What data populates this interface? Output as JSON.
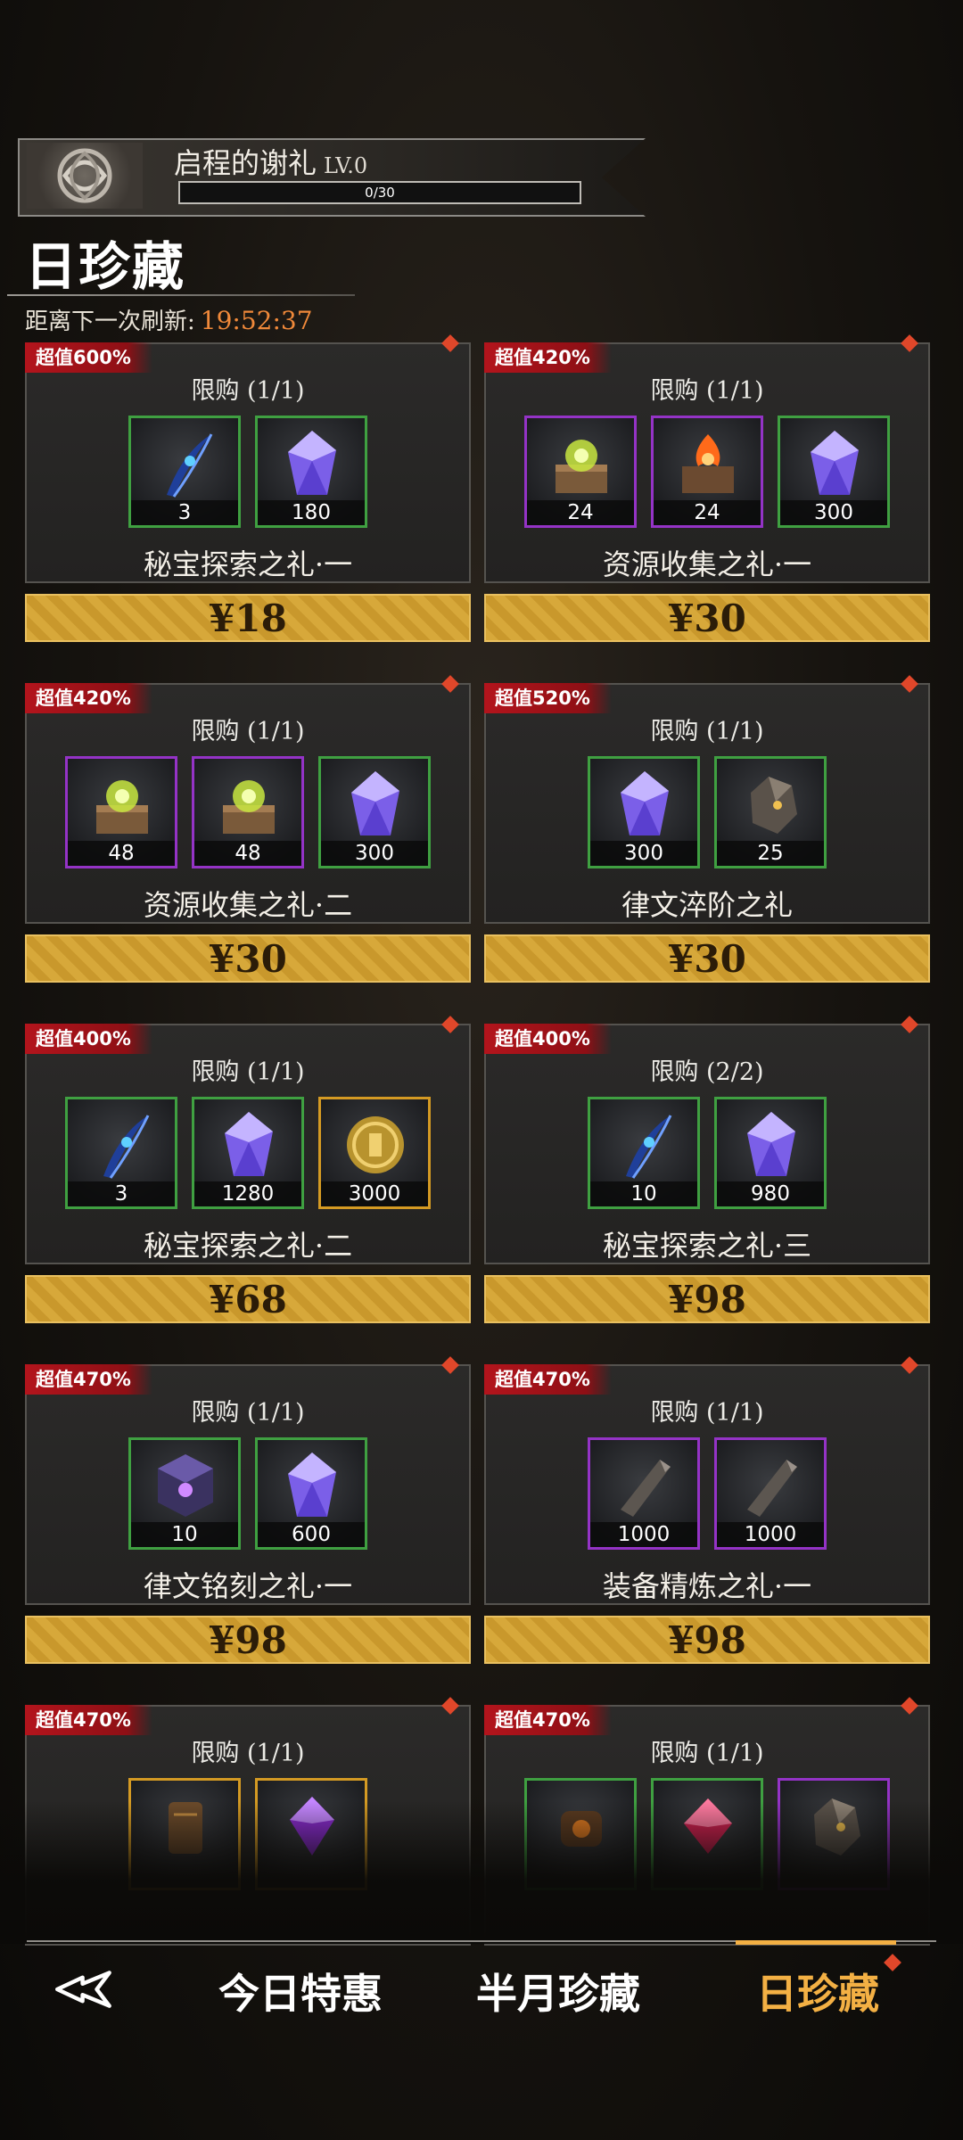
{
  "header": {
    "title": "启程的谢礼",
    "level": "LV.0",
    "progress_text": "0/30",
    "progress_fraction": 0
  },
  "page": {
    "title": "日珍藏",
    "refresh_label": "距离下一次刷新:",
    "refresh_time": "19:52:37"
  },
  "cards": [
    {
      "badge": "超值600%",
      "limit": "限购 (1/1)",
      "name": "秘宝探索之礼·一",
      "price": "¥18",
      "items": [
        {
          "count": "3",
          "rarity": "green",
          "icon": "feather-icon"
        },
        {
          "count": "180",
          "rarity": "green",
          "icon": "crystal-icon"
        }
      ]
    },
    {
      "badge": "超值420%",
      "limit": "限购 (1/1)",
      "name": "资源收集之礼·一",
      "price": "¥30",
      "items": [
        {
          "count": "24",
          "rarity": "purple",
          "icon": "chest-icon"
        },
        {
          "count": "24",
          "rarity": "purple",
          "icon": "fire-chest-icon"
        },
        {
          "count": "300",
          "rarity": "green",
          "icon": "crystal-icon"
        }
      ]
    },
    {
      "badge": "超值420%",
      "limit": "限购 (1/1)",
      "name": "资源收集之礼·二",
      "price": "¥30",
      "items": [
        {
          "count": "48",
          "rarity": "purple",
          "icon": "chest-icon"
        },
        {
          "count": "48",
          "rarity": "purple",
          "icon": "chest-icon"
        },
        {
          "count": "300",
          "rarity": "green",
          "icon": "crystal-icon"
        }
      ]
    },
    {
      "badge": "超值520%",
      "limit": "限购 (1/1)",
      "name": "律文淬阶之礼",
      "price": "¥30",
      "items": [
        {
          "count": "300",
          "rarity": "green",
          "icon": "crystal-icon"
        },
        {
          "count": "25",
          "rarity": "green",
          "icon": "ore-icon"
        }
      ]
    },
    {
      "badge": "超值400%",
      "limit": "限购 (1/1)",
      "name": "秘宝探索之礼·二",
      "price": "¥68",
      "items": [
        {
          "count": "3",
          "rarity": "green",
          "icon": "feather-icon"
        },
        {
          "count": "1280",
          "rarity": "green",
          "icon": "crystal-icon"
        },
        {
          "count": "3000",
          "rarity": "gold",
          "icon": "coin-icon"
        }
      ]
    },
    {
      "badge": "超值400%",
      "limit": "限购 (2/2)",
      "name": "秘宝探索之礼·三",
      "price": "¥98",
      "items": [
        {
          "count": "10",
          "rarity": "green",
          "icon": "feather-icon"
        },
        {
          "count": "980",
          "rarity": "green",
          "icon": "crystal-icon"
        }
      ]
    },
    {
      "badge": "超值470%",
      "limit": "限购 (1/1)",
      "name": "律文铭刻之礼·一",
      "price": "¥98",
      "items": [
        {
          "count": "10",
          "rarity": "green",
          "icon": "rune-cube-icon"
        },
        {
          "count": "600",
          "rarity": "green",
          "icon": "crystal-icon"
        }
      ]
    },
    {
      "badge": "超值470%",
      "limit": "限购 (1/1)",
      "name": "装备精炼之礼·一",
      "price": "¥98",
      "items": [
        {
          "count": "1000",
          "rarity": "purple",
          "icon": "whetstone-icon"
        },
        {
          "count": "1000",
          "rarity": "purple",
          "icon": "whetstone-icon"
        }
      ]
    },
    {
      "badge": "超值470%",
      "limit": "限购 (1/1)",
      "name": "",
      "price": "",
      "items": [
        {
          "count": "",
          "rarity": "gold",
          "icon": "scroll-icon"
        },
        {
          "count": "",
          "rarity": "gold",
          "icon": "purple-gem-icon"
        }
      ]
    },
    {
      "badge": "超值470%",
      "limit": "限购 (1/1)",
      "name": "",
      "price": "",
      "items": [
        {
          "count": "",
          "rarity": "green",
          "icon": "amulet-icon"
        },
        {
          "count": "",
          "rarity": "green",
          "icon": "red-gem-icon"
        },
        {
          "count": "",
          "rarity": "purple",
          "icon": "ore-icon"
        }
      ]
    }
  ],
  "nav": {
    "tabs": [
      "今日特惠",
      "半月珍藏",
      "日珍藏"
    ],
    "active_index": 2
  },
  "colors": {
    "badge_red": "#b3141c",
    "price_gold": "#d7a83a",
    "rarity_green": "#3fa041",
    "rarity_purple": "#9433c6",
    "rarity_gold": "#d49a23",
    "timer_orange": "#f0893a",
    "active_tab": "#f3b044"
  }
}
